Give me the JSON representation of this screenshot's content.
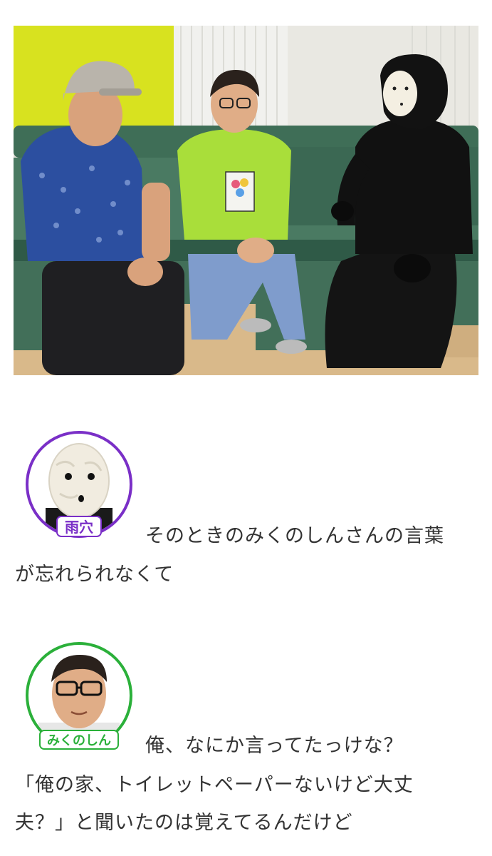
{
  "photo": {
    "alt": "",
    "colors": {
      "wall_yellow": "#d8e21f",
      "bench_green": "#3f6e57",
      "wood": "#d9b98a",
      "shirt_lime": "#a9de3a",
      "shirt_blue": "#2c4fa0",
      "bodysuit": "#111111"
    }
  },
  "dialogue": [
    {
      "speaker": "雨穴",
      "avatar_border_color": "#7a2fc7",
      "avatar_label_color": "#7a2fc7",
      "lines": [
        "そのときのみくのしんさんの言葉",
        "が忘れられなくて"
      ]
    },
    {
      "speaker": "みくのしん",
      "avatar_border_color": "#2bb03a",
      "avatar_label_color": "#2bb03a",
      "lines": [
        "俺、なにか言ってたっけな？",
        "「俺の家、トイレットペーパーないけど大丈",
        "夫？」と聞いたのは覚えてるんだけど"
      ]
    }
  ]
}
